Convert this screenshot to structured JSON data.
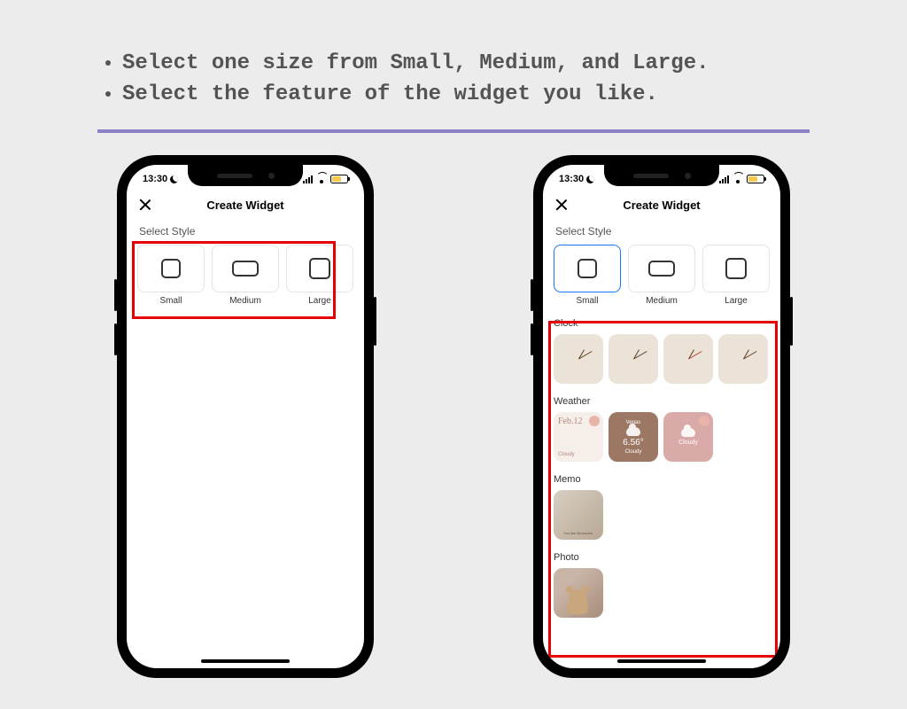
{
  "instructions": {
    "item1": "Select one size from Small, Medium, and Large.",
    "item2": "Select the feature of the widget you like."
  },
  "statusbar": {
    "time": "13:30"
  },
  "header": {
    "title": "Create Widget"
  },
  "section": {
    "select_style": "Select Style"
  },
  "sizes": {
    "small": "Small",
    "medium": "Medium",
    "large": "Large"
  },
  "categories": {
    "clock": "Clock",
    "weather": "Weather",
    "memo": "Memo",
    "photo": "Photo"
  },
  "weather": {
    "w1_date": "Feb.12",
    "w1_cond": "Cloudy",
    "w2_city": "Vegas",
    "w2_temp": "6.56°",
    "w2_cond": "Cloudy",
    "w3_cond": "Cloudy"
  },
  "memo": {
    "text": "You like Memories."
  }
}
